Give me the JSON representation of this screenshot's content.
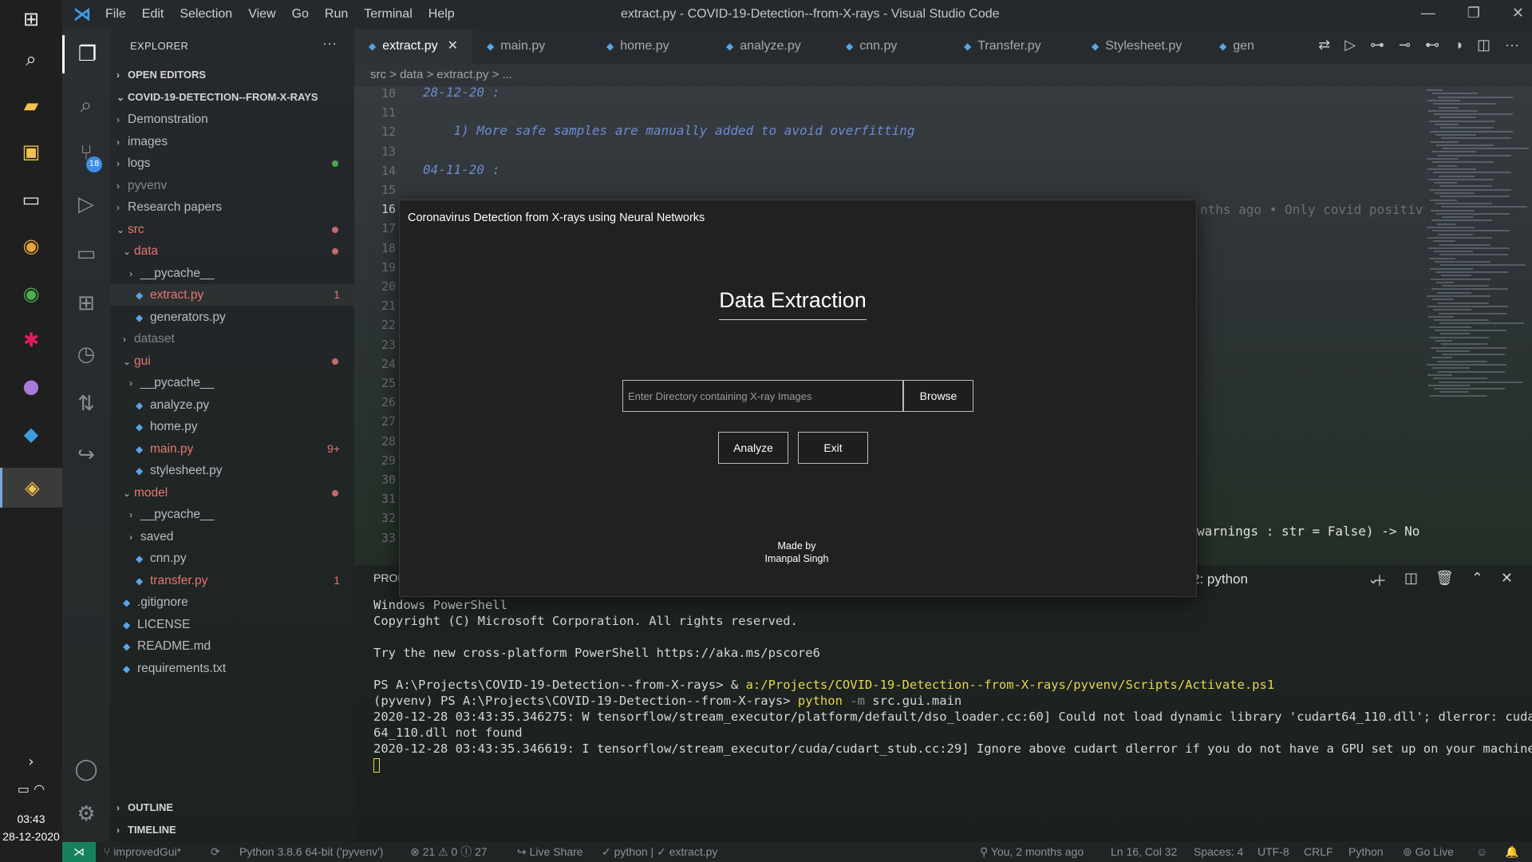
{
  "window": {
    "title": "extract.py - COVID-19-Detection--from-X-rays - Visual Studio Code",
    "menu": [
      "File",
      "Edit",
      "Selection",
      "View",
      "Go",
      "Run",
      "Terminal",
      "Help"
    ]
  },
  "taskbar": {
    "time": "03:43",
    "date": "28-12-2020",
    "icons": [
      "windows-start-icon",
      "search-icon",
      "file-explorer-icon",
      "store-icon",
      "terminal-icon",
      "chrome-canary-icon",
      "chrome-icon",
      "slack-icon",
      "github-desktop-icon",
      "vscode-icon",
      "python-icon"
    ]
  },
  "activity_bar": {
    "scm_badge": "18"
  },
  "explorer": {
    "header": "EXPLORER",
    "open_editors": "OPEN EDITORS",
    "root": "COVID-19-DETECTION--FROM-X-RAYS",
    "items": [
      {
        "label": "Demonstration",
        "kind": "folder",
        "depth": 1
      },
      {
        "label": "images",
        "kind": "folder",
        "depth": 1
      },
      {
        "label": "logs",
        "kind": "folder",
        "depth": 1
      },
      {
        "label": "pyvenv",
        "kind": "folder",
        "depth": 1
      },
      {
        "label": "Research papers",
        "kind": "folder",
        "depth": 1
      },
      {
        "label": "src",
        "kind": "folder-open",
        "depth": 1
      },
      {
        "label": "data",
        "kind": "folder-open",
        "depth": 2
      },
      {
        "label": "__pycache__",
        "kind": "folder",
        "depth": 3
      },
      {
        "label": "extract.py",
        "kind": "file",
        "depth": 3,
        "decoration": "1"
      },
      {
        "label": "generators.py",
        "kind": "file",
        "depth": 3
      },
      {
        "label": "dataset",
        "kind": "folder",
        "depth": 2
      },
      {
        "label": "gui",
        "kind": "folder-open",
        "depth": 2
      },
      {
        "label": "__pycache__",
        "kind": "folder",
        "depth": 3
      },
      {
        "label": "analyze.py",
        "kind": "file",
        "depth": 3
      },
      {
        "label": "home.py",
        "kind": "file",
        "depth": 3
      },
      {
        "label": "main.py",
        "kind": "file",
        "depth": 3,
        "decoration": "9+"
      },
      {
        "label": "stylesheet.py",
        "kind": "file",
        "depth": 3
      },
      {
        "label": "model",
        "kind": "folder-open",
        "depth": 2
      },
      {
        "label": "__pycache__",
        "kind": "folder",
        "depth": 3
      },
      {
        "label": "saved",
        "kind": "folder",
        "depth": 3
      },
      {
        "label": "cnn.py",
        "kind": "file",
        "depth": 3
      },
      {
        "label": "transfer.py",
        "kind": "file",
        "depth": 3,
        "decoration": "1"
      },
      {
        "label": ".gitignore",
        "kind": "file",
        "depth": 1
      },
      {
        "label": "LICENSE",
        "kind": "file",
        "depth": 1
      },
      {
        "label": "README.md",
        "kind": "file",
        "depth": 1
      },
      {
        "label": "requirements.txt",
        "kind": "file",
        "depth": 1
      }
    ],
    "outline": "OUTLINE",
    "timeline": "TIMELINE"
  },
  "tabs": [
    {
      "label": "extract.py",
      "active": true
    },
    {
      "label": "main.py"
    },
    {
      "label": "home.py"
    },
    {
      "label": "analyze.py"
    },
    {
      "label": "cnn.py"
    },
    {
      "label": "Transfer.py"
    },
    {
      "label": "Stylesheet.py"
    },
    {
      "label": "gen"
    }
  ],
  "breadcrumb": "src > data > extract.py > ...",
  "code": {
    "lines": [
      {
        "n": "10",
        "text": "28-12-20 :"
      },
      {
        "n": "11",
        "text": ""
      },
      {
        "n": "12",
        "text": "    1) More safe samples are manually added to avoid overfitting"
      },
      {
        "n": "13",
        "text": ""
      },
      {
        "n": "14",
        "text": "04-11-20 :"
      },
      {
        "n": "15",
        "text": ""
      },
      {
        "n": "16",
        "text": ""
      },
      {
        "n": "17",
        "text": ""
      },
      {
        "n": "18",
        "text": ""
      },
      {
        "n": "19",
        "text": ""
      },
      {
        "n": "20",
        "text": ""
      },
      {
        "n": "21",
        "text": ""
      },
      {
        "n": "22",
        "text": ""
      },
      {
        "n": "23",
        "text": ""
      },
      {
        "n": "24",
        "text": ""
      },
      {
        "n": "25",
        "text": ""
      },
      {
        "n": "26",
        "text": ""
      },
      {
        "n": "27",
        "text": ""
      },
      {
        "n": "28",
        "text": ""
      },
      {
        "n": "29",
        "text": ""
      },
      {
        "n": "30",
        "text": ""
      },
      {
        "n": "31",
        "text": ""
      },
      {
        "n": "32",
        "text": ""
      },
      {
        "n": "33",
        "text": ""
      }
    ],
    "blame": "nths ago • Only covid positiv",
    "signature": "warnings : str = False) -> No"
  },
  "panel": {
    "tab": "PROB",
    "shell": "2: python"
  },
  "terminal": {
    "lines": [
      "Windows PowerShell",
      "Copyright (C) Microsoft Corporation. All rights reserved.",
      "",
      "Try the new cross-platform PowerShell https://aka.ms/pscore6",
      "",
      "PS A:\\Projects\\COVID-19-Detection--from-X-rays> & ",
      "(pyvenv) PS A:\\Projects\\COVID-19-Detection--from-X-rays> ",
      "2020-12-28 03:43:35.346275: W tensorflow/stream_executor/platform/default/dso_loader.cc:60] Could not load dynamic library 'cudart64_110.dll'; dlerror: cudart",
      "64_110.dll not found",
      "2020-12-28 03:43:35.346619: I tensorflow/stream_executor/cuda/cudart_stub.cc:29] Ignore above cudart dlerror if you do not have a GPU set up on your machine."
    ],
    "activate_cmd": "a:/Projects/COVID-19-Detection--from-X-rays/pyvenv/Scripts/Activate.ps1",
    "python_cmd": "python",
    "python_flag": "-m",
    "python_module": "src.gui.main"
  },
  "statusbar": {
    "branch": "improvedGui*",
    "interpreter": "Python 3.8.6 64-bit ('pyvenv')",
    "problems": "⊗ 21 ⚠ 0 ⓘ 27",
    "live_share": "Live Share",
    "task": "python | ✓ extract.py",
    "blame": "You, 2 months ago",
    "position": "Ln 16, Col 32",
    "spaces": "Spaces: 4",
    "encoding": "UTF-8",
    "eol": "CRLF",
    "language": "Python",
    "go_live": "Go Live"
  },
  "app_dialog": {
    "title": "Coronavirus Detection from X-rays using Neural Networks",
    "heading": "Data Extraction",
    "input_placeholder": "Enter Directory containing X-ray Images",
    "browse": "Browse",
    "analyze": "Analyze",
    "exit": "Exit",
    "made_by": "Made by",
    "author": "Imanpal Singh"
  }
}
